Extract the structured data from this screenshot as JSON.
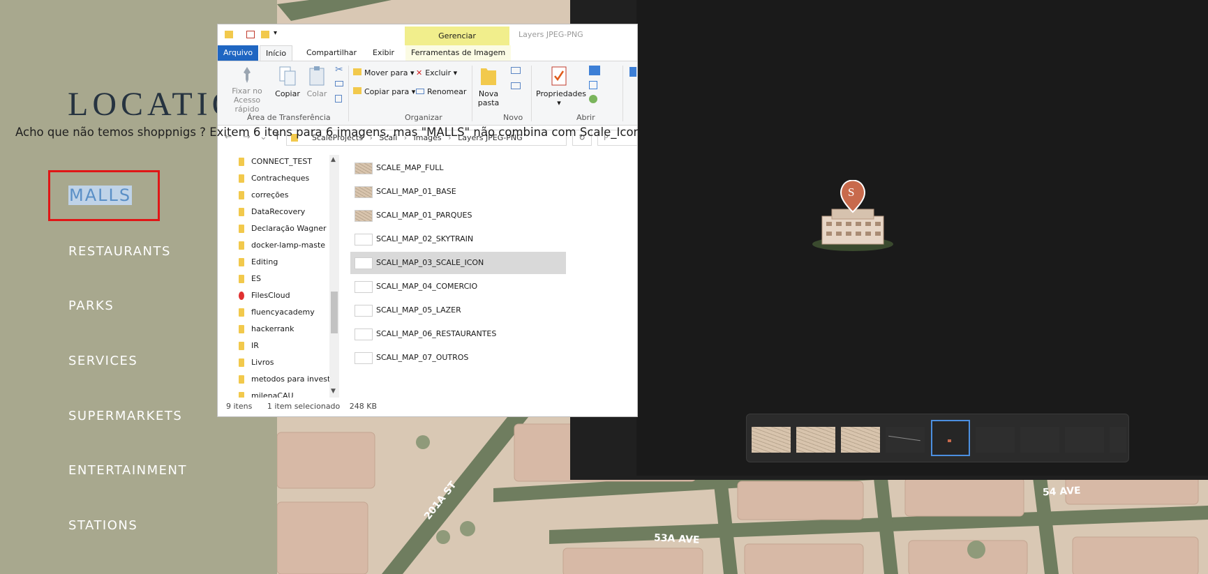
{
  "left_panel": {
    "title": "LOCATIO",
    "nav_items": [
      "MALLS",
      "RESTAURANTS",
      "PARKS",
      "SERVICES",
      "SUPERMARKETS",
      "ENTERTAINMENT",
      "STATIONS"
    ],
    "active_item": "MALLS",
    "highlight_color": "#e01616"
  },
  "comment": "Acho que não temos shoppnigs ? Exitem 6 itens para 6 imagens, mas \"MALLS\" não combina com Scale_Icon",
  "map": {
    "street_labels": [
      "54 AVE",
      "53A AVE",
      "201A ST"
    ],
    "colors": {
      "block": "#d7b9a6",
      "road": "#6f7d5f",
      "ground": "#d9c8b4"
    }
  },
  "explorer": {
    "window_title": "Layers JPEG-PNG",
    "contextual_tab_header": "Gerenciar",
    "tabs": [
      "Arquivo",
      "Início",
      "Compartilhar",
      "Exibir",
      "Ferramentas de Imagem"
    ],
    "active_tab": "Início",
    "ribbon": {
      "groups": [
        "Área de Transferência",
        "Organizar",
        "Novo",
        "Abrir"
      ],
      "pin_label": "Fixar no Acesso rápido",
      "copy_label": "Copiar",
      "paste_label": "Colar",
      "move_to_label": "Mover para",
      "copy_to_label": "Copiar para",
      "delete_label": "Excluir",
      "rename_label": "Renomear",
      "new_folder_label": "Nova pasta",
      "properties_label": "Propriedades"
    },
    "breadcrumbs": [
      "ScaleProjects",
      "Scali",
      "images",
      "Layers JPEG-PNG"
    ],
    "search_placeholder": "P",
    "nav_folders": [
      "CONNECT_TEST",
      "Contracheques",
      "correções",
      "DataRecovery",
      "Declaração Wagner",
      "docker-lamp-maste",
      "Editing",
      "ES",
      "FilesCloud",
      "fluencyacademy",
      "hackerrank",
      "IR",
      "Livros",
      "metodos para invest",
      "milenaCAU"
    ],
    "files": [
      "SCALE_MAP_FULL",
      "SCALI_MAP_01_BASE",
      "SCALI_MAP_01_PARQUES",
      "SCALI_MAP_02_SKYTRAIN",
      "SCALI_MAP_03_SCALE_ICON",
      "SCALI_MAP_04_COMERCIO",
      "SCALI_MAP_05_LAZER",
      "SCALI_MAP_06_RESTAURANTES",
      "SCALI_MAP_07_OUTROS"
    ],
    "selected_file": "SCALI_MAP_03_SCALE_ICON",
    "status": {
      "count": "9 itens",
      "selection": "1 item selecionado",
      "size": "248 KB"
    }
  },
  "viewer": {
    "pin_letter": "S",
    "pin_color": "#c86a4c",
    "background": "#1f1f1f",
    "filmstrip_selected_index": 4,
    "filmstrip_count": 9
  }
}
